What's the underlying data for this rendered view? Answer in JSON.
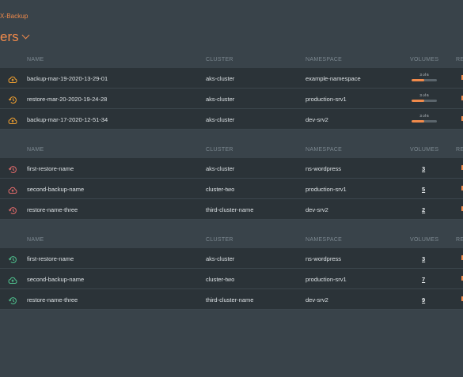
{
  "breadcrumb": "X-Backup",
  "page_title": "ers",
  "columns": {
    "name": "NAME",
    "cluster": "CLUSTER",
    "namespace": "NAMESPACE",
    "volumes": "VOLUMES",
    "extra": "RE"
  },
  "colors": {
    "accent_orange": "#f08a4b",
    "restore_red": "#e06a6a",
    "restore_green": "#4fc08d"
  },
  "sections": [
    {
      "rows": [
        {
          "icon": "cloud-upload-icon",
          "icon_color": "#f0a030",
          "name": "backup-mar-19-2020-13-29-01",
          "cluster": "aks-cluster",
          "namespace": "example-namespace",
          "progress_label": "3 of 6",
          "progress": 0.5
        },
        {
          "icon": "restore-history-icon",
          "icon_color": "#f0a030",
          "name": "restore-mar-20-2020-19-24-28",
          "cluster": "aks-cluster",
          "namespace": "production-srv1",
          "progress_label": "3 of 6",
          "progress": 0.5
        },
        {
          "icon": "cloud-upload-icon",
          "icon_color": "#f0a030",
          "name": "backup-mar-17-2020-12-51-34",
          "cluster": "aks-cluster",
          "namespace": "dev-srv2",
          "progress_label": "3 of 6",
          "progress": 0.5
        }
      ]
    },
    {
      "rows": [
        {
          "icon": "restore-history-icon",
          "icon_color": "#e06a6a",
          "name": "first-restore-name",
          "cluster": "aks-cluster",
          "namespace": "ns-wordpress",
          "volumes": "3"
        },
        {
          "icon": "cloud-upload-icon",
          "icon_color": "#e06a6a",
          "name": "second-backup-name",
          "cluster": "cluster-two",
          "namespace": "production-srv1",
          "volumes": "5"
        },
        {
          "icon": "restore-history-icon",
          "icon_color": "#e06a6a",
          "name": "restore-name-three",
          "cluster": "third-cluster-name",
          "namespace": "dev-srv2",
          "volumes": "2"
        }
      ]
    },
    {
      "rows": [
        {
          "icon": "restore-history-icon",
          "icon_color": "#4fc08d",
          "name": "first-restore-name",
          "cluster": "aks-cluster",
          "namespace": "ns-wordpress",
          "volumes": "3"
        },
        {
          "icon": "cloud-upload-icon",
          "icon_color": "#4fc08d",
          "name": "second-backup-name",
          "cluster": "cluster-two",
          "namespace": "production-srv1",
          "volumes": "7"
        },
        {
          "icon": "restore-history-icon",
          "icon_color": "#4fc08d",
          "name": "restore-name-three",
          "cluster": "third-cluster-name",
          "namespace": "dev-srv2",
          "volumes": "9"
        }
      ]
    }
  ]
}
